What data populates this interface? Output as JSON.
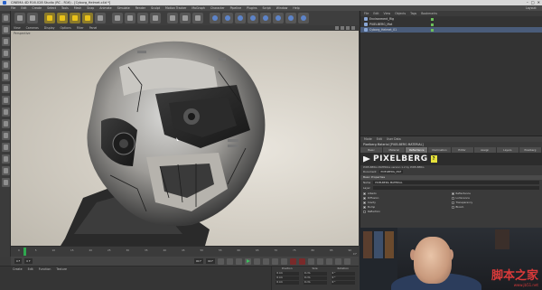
{
  "window": {
    "title": "CINEMA 4D R16.028 Studio (RC - R16) - [Cyborg_Helmet.c4d *]",
    "controls": [
      "–",
      "□",
      "✕"
    ]
  },
  "menubar": {
    "items": [
      "File",
      "Edit",
      "Create",
      "Select",
      "Tools",
      "Mesh",
      "Snap",
      "Animate",
      "Simulate",
      "Render",
      "Sculpt",
      "Motion Tracker",
      "MoGraph",
      "Character",
      "Pipeline",
      "Plugins",
      "Script",
      "Window",
      "Help"
    ],
    "layout_label": "Layout:"
  },
  "toolbar": {
    "icons": [
      "undo-icon",
      "redo-icon",
      "live-select-icon",
      "move-icon",
      "scale-icon",
      "rotate-icon",
      "recent-tool-icon",
      "x-axis-icon",
      "y-axis-icon",
      "z-axis-icon",
      "coordinate-system-icon",
      "render-view-icon",
      "render-picture-viewer-icon",
      "edit-render-settings-icon",
      "cube-icon",
      "pen-icon",
      "subdivision-icon",
      "array-icon",
      "deformer-icon",
      "floor-icon",
      "camera-icon",
      "light-icon"
    ]
  },
  "viewport": {
    "menu": [
      "View",
      "Cameras",
      "Display",
      "Options",
      "Filter",
      "Panel"
    ],
    "label": "Perspective"
  },
  "timeline": {
    "ticks": [
      "0",
      "5",
      "10",
      "15",
      "20",
      "25",
      "30",
      "35",
      "40",
      "45",
      "50",
      "55",
      "60",
      "65",
      "70",
      "75",
      "80",
      "85",
      "90"
    ],
    "end_frame": "0 F",
    "start_field": "0 F",
    "current_field": "0 F",
    "end_field": "90 F",
    "max_field": "90 F"
  },
  "materials": {
    "menu": [
      "Create",
      "Edit",
      "Function",
      "Texture"
    ]
  },
  "coordinates": {
    "headers": [
      "Position",
      "Size",
      "Rotation"
    ],
    "rows": [
      [
        "0 cm",
        "0 cm",
        "0 °"
      ],
      [
        "0 cm",
        "0 cm",
        "0 °"
      ],
      [
        "0 cm",
        "0 cm",
        "0 °"
      ]
    ]
  },
  "objects": {
    "menu": [
      "File",
      "Edit",
      "View",
      "Objects",
      "Tags",
      "Bookmarks"
    ],
    "items": [
      {
        "name": "Environment_Rig"
      },
      {
        "name": "PIXELBERG_Mat"
      },
      {
        "name": "Cyborg_Helmet_01"
      }
    ]
  },
  "attributes": {
    "menu": [
      "Mode",
      "Edit",
      "User Data"
    ],
    "title": "Pixelberg Material [PIXELBERG MATERIAL]",
    "tabs": [
      "Basic",
      "Material",
      "Reflectance",
      "Illumination",
      "Editor",
      "Assign",
      "Layers",
      "Pixelberg"
    ],
    "active_tab": 2,
    "logo_text": "PIXELBERG",
    "subtitle": "PIXELBERG MATERIAL version 1.2 by PIXELBERG",
    "doc_label": "Document",
    "doc_value": "PIXELBERG_MAT",
    "section": "Basic Properties",
    "name_label": "Name",
    "name_value": "PIXELBERG MATERIAL",
    "layer_label": "Layer",
    "channels": [
      {
        "label": "Albedo",
        "checked": true
      },
      {
        "label": "Reflectance",
        "checked": true
      },
      {
        "label": "Diffusion",
        "checked": true
      },
      {
        "label": "Luminance",
        "checked": false
      },
      {
        "label": "Cavity",
        "checked": true
      },
      {
        "label": "Transparency",
        "checked": false
      },
      {
        "label": "Bump",
        "checked": true
      },
      {
        "label": "Bloom",
        "checked": false
      },
      {
        "label": "Reflection",
        "checked": false
      }
    ]
  },
  "watermark": {
    "text": "脚本之家",
    "url": "www.jb51.net"
  },
  "colors": {
    "accent_yellow": "#e9c21a",
    "selection_blue": "#4a5c7a",
    "playhead_green": "#2fa84f",
    "watermark_red": "#d93a3a"
  }
}
